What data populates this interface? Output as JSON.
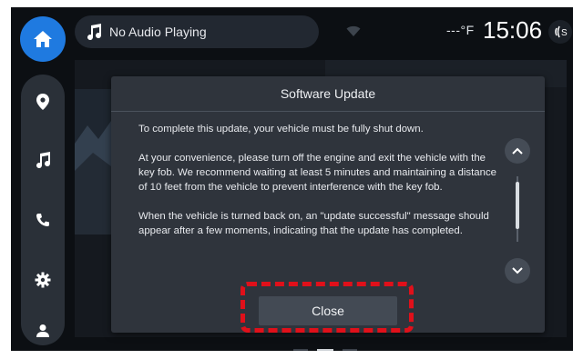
{
  "status_bar": {
    "media_text": "No Audio Playing",
    "temperature": "---°F",
    "time": "15:06"
  },
  "nav": {
    "items": [
      "home",
      "navigation",
      "media",
      "phone",
      "settings",
      "profile"
    ]
  },
  "dialog": {
    "title": "Software Update",
    "paragraphs": [
      "To complete this update, your vehicle must be fully shut down.",
      "At your convenience, please turn off the engine and exit the vehicle with the key fob. We recommend waiting at least 5 minutes and maintaining a distance of 10 feet from the vehicle to prevent interference with the key fob.",
      "When the vehicle is turned back on, an \"update successful\" message should appear after a few moments, indicating that the update has completed."
    ],
    "close_label": "Close"
  },
  "colors": {
    "accent": "#1f7ae0",
    "highlight": "#e0101a",
    "screen_bg": "#0c0f13",
    "dialog_bg": "#2f343c"
  }
}
